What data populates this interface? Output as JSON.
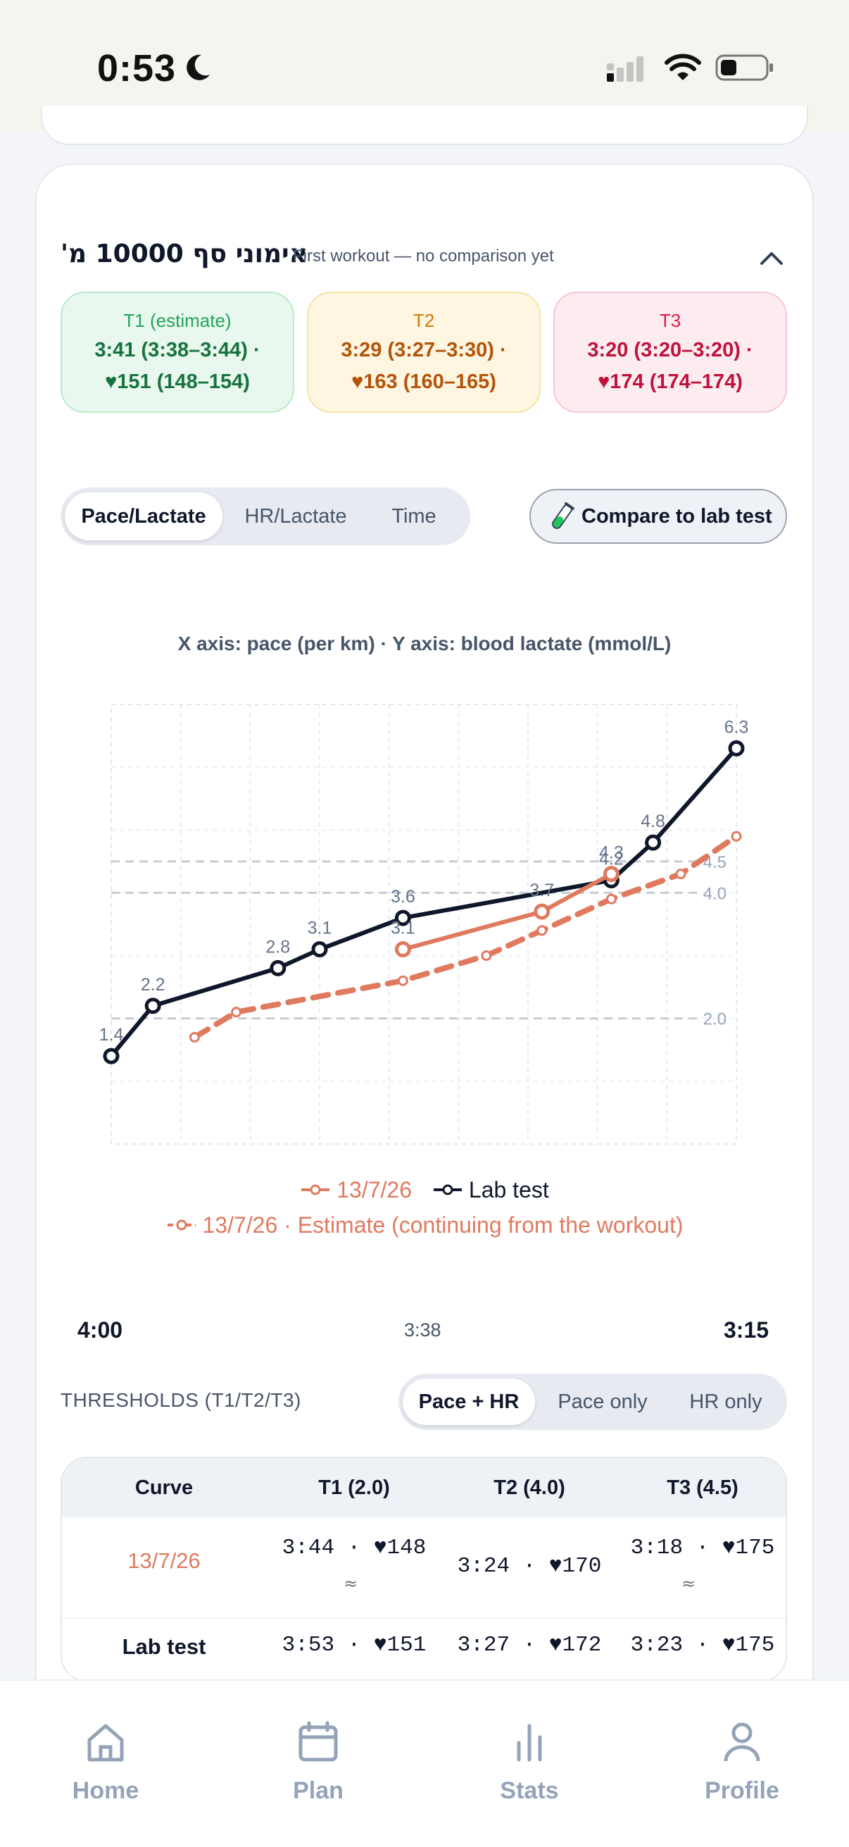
{
  "status_bar": {
    "time": "0:53"
  },
  "workout": {
    "title": "אימוני סף 10000 מ'",
    "subtitle": "First workout — no comparison yet"
  },
  "thresholds_summary": [
    {
      "label": "T1 (estimate)",
      "line1": "3:41 (3:38–3:44) ·",
      "line2": "♥151 (148–154)"
    },
    {
      "label": "T2",
      "line1": "3:29 (3:27–3:30) ·",
      "line2": "♥163 (160–165)"
    },
    {
      "label": "T3",
      "line1": "3:20 (3:20–3:20) ·",
      "line2": "♥174 (174–174)"
    }
  ],
  "chart_tabs": [
    "Pace/Lactate",
    "HR/Lactate",
    "Time"
  ],
  "compare_button": "Compare to lab test",
  "axis_caption": "X axis: pace (per km) · Y axis: blood lactate (mmol/L)",
  "chart_data": {
    "type": "line",
    "x_unit": "pace per km",
    "x_range": [
      "4:00",
      "3:15"
    ],
    "y_unit": "mmol/L",
    "reference_lines": [
      2.0,
      4.0,
      4.5
    ],
    "series": [
      {
        "name": "Lab test",
        "color": "#0f172a",
        "points": [
          {
            "x": "4:00",
            "y": 1.4
          },
          {
            "x": "3:57",
            "y": 2.2
          },
          {
            "x": "3:48",
            "y": 2.8
          },
          {
            "x": "3:45",
            "y": 3.1
          },
          {
            "x": "3:39",
            "y": 3.6
          },
          {
            "x": "3:24",
            "y": 4.2
          },
          {
            "x": "3:21",
            "y": 4.8
          },
          {
            "x": "3:15",
            "y": 6.3
          }
        ]
      },
      {
        "name": "13/7/26",
        "color": "#e07a5f",
        "points": [
          {
            "x": "3:39",
            "y": 3.1
          },
          {
            "x": "3:29",
            "y": 3.7
          },
          {
            "x": "3:24",
            "y": 4.3
          }
        ]
      },
      {
        "name": "13/7/26 · Estimate (continuing from the workout)",
        "color": "#e07a5f",
        "dashed": true,
        "points": [
          {
            "x": "3:54",
            "y": 1.7
          },
          {
            "x": "3:51",
            "y": 2.1
          },
          {
            "x": "3:39",
            "y": 2.6
          },
          {
            "x": "3:33",
            "y": 3.0
          },
          {
            "x": "3:29",
            "y": 3.4
          },
          {
            "x": "3:24",
            "y": 3.9
          },
          {
            "x": "3:19",
            "y": 4.3
          },
          {
            "x": "3:15",
            "y": 4.9
          }
        ]
      }
    ]
  },
  "legend": {
    "workout": "13/7/26",
    "lab": "Lab test",
    "estimate": "13/7/26 · Estimate (continuing from the workout)"
  },
  "pace_slider": {
    "left": "4:00",
    "current": "3:38",
    "right": "3:15"
  },
  "thresholds_section": {
    "title": "THRESHOLDS (T1/T2/T3)",
    "modes": [
      "Pace + HR",
      "Pace only",
      "HR only"
    ],
    "columns": [
      "Curve",
      "T1 (2.0)",
      "T2 (4.0)",
      "T3 (4.5)"
    ],
    "rows": [
      {
        "curve": "13/7/26",
        "t1": "3:44 · ♥148",
        "t1_note": "≈",
        "t2": "3:24 · ♥170",
        "t3": "3:18 · ♥175",
        "t3_note": "≈"
      },
      {
        "curve": "Lab test",
        "t1": "3:53 · ♥151",
        "t2": "3:27 · ♥172",
        "t3": "3:23 · ♥175"
      }
    ]
  },
  "tabbar": [
    "Home",
    "Plan",
    "Stats",
    "Profile"
  ]
}
